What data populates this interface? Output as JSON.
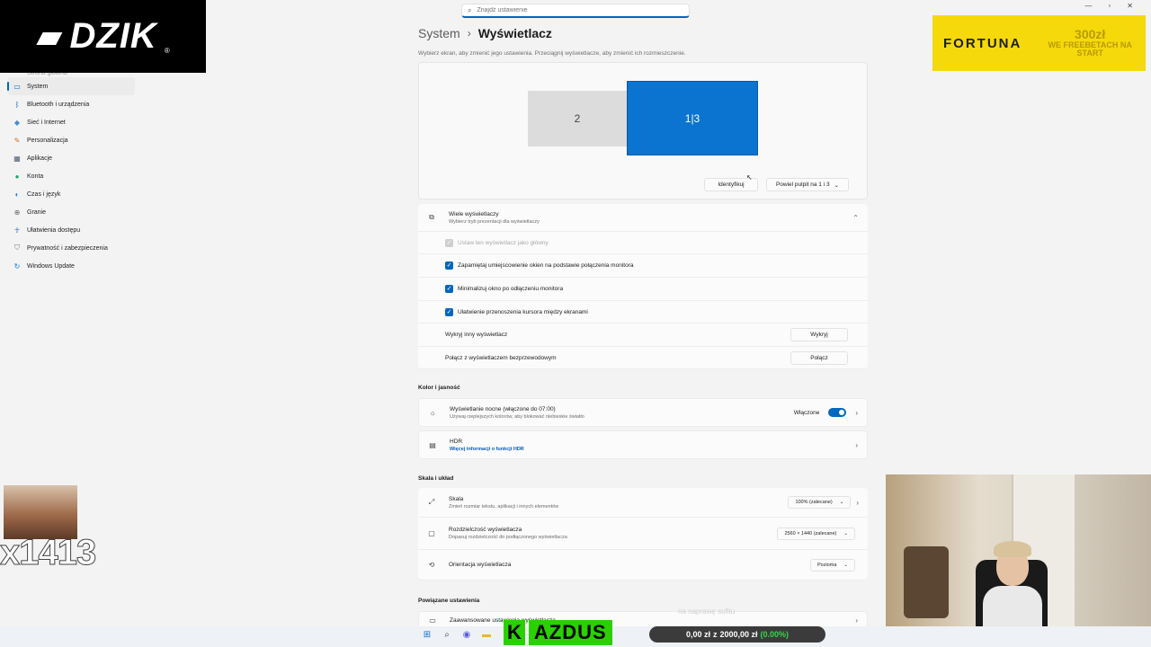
{
  "titlebar": {
    "search_placeholder": "Znajdź ustawienie",
    "search_icon": "search-icon",
    "minimize": "—",
    "maximize": "▫",
    "close": "✕"
  },
  "overlays": {
    "brand_text": "DZIK",
    "brand_reg": "®",
    "brand_icon": "boar-icon",
    "ad_brand": "FORTUNA",
    "ad_amount": "300zł",
    "ad_tagline": "WE FREEBETACH NA START",
    "donor_count": "x1413",
    "streamer_name_k": "K",
    "streamer_name_rest": "AZDUS",
    "bank_text_left": "0,00 zł",
    "bank_text_sep": "z",
    "bank_text_right": "2000,00 zł",
    "bank_pct": "(0.00%)",
    "ghost_text": "na naprawę sufitu"
  },
  "sidebar": {
    "faded_item": "Strona główna",
    "items": [
      {
        "label": "System",
        "icon": "monitor-icon",
        "glyph": "▭",
        "color": "#0067c0"
      },
      {
        "label": "Bluetooth i urządzenia",
        "icon": "bluetooth-icon",
        "glyph": "ᛒ",
        "color": "#0067c0"
      },
      {
        "label": "Sieć i Internet",
        "icon": "wifi-icon",
        "glyph": "◆",
        "color": "#4b8ad6"
      },
      {
        "label": "Personalizacja",
        "icon": "brush-icon",
        "glyph": "✎",
        "color": "#c2702b"
      },
      {
        "label": "Aplikacje",
        "icon": "apps-icon",
        "glyph": "▦",
        "color": "#4d5d73"
      },
      {
        "label": "Konta",
        "icon": "account-icon",
        "glyph": "●",
        "color": "#25a56a"
      },
      {
        "label": "Czas i język",
        "icon": "globe-icon",
        "glyph": "◐",
        "color": "#1b7bd1"
      },
      {
        "label": "Granie",
        "icon": "gamepad-icon",
        "glyph": "⊕",
        "color": "#666"
      },
      {
        "label": "Ułatwienia dostępu",
        "icon": "accessibility-icon",
        "glyph": "☥",
        "color": "#1a63b4"
      },
      {
        "label": "Prywatność i zabezpieczenia",
        "icon": "shield-icon",
        "glyph": "⛉",
        "color": "#777"
      },
      {
        "label": "Windows Update",
        "icon": "update-icon",
        "glyph": "↻",
        "color": "#0a74d0"
      }
    ]
  },
  "header": {
    "breadcrumb_parent": "System",
    "breadcrumb_sep": "›",
    "page_title": "Wyświetlacz",
    "hint": "Wybierz ekran, aby zmienić jego ustawienia. Przeciągnij wyświetlacze, aby zmienić ich rozmieszczenie."
  },
  "monitors": {
    "secondary": "2",
    "primary": "1|3",
    "identify_button": "Identyfikuj",
    "duplicate_dropdown": "Powiel pulpit na 1 i 3",
    "dropdown_arrow": "⌄"
  },
  "multi": {
    "title": "Wiele wyświetlaczy",
    "subtitle": "Wybierz tryb prezentacji dla wyświetlaczy",
    "chevron_up": "⌃",
    "make_main": "Ustaw ten wyświetlacz jako główny",
    "remember": "Zapamiętaj umiejscowienie okien na podstawie połączenia monitora",
    "minimize": "Minimalizuj okno po odłączeniu monitora",
    "ease_cursor": "Ułatwienie przenoszenia kursora między ekranami",
    "detect_label": "Wykryj inny wyświetlacz",
    "detect_button": "Wykryj",
    "wireless_label": "Połącz z wyświetlaczem bezprzewodowym",
    "wireless_button": "Połącz",
    "checkmark": "✓"
  },
  "color": {
    "section": "Kolor i jasność",
    "night_title": "Wyświetlanie nocne (włączone do 07:00)",
    "night_sub": "Używaj cieplejszych kolorów, aby blokować niebieskie światło",
    "night_state": "Włączone",
    "hdr_title": "HDR",
    "hdr_link": "Więcej informacji o funkcji HDR",
    "chevron": "›"
  },
  "layout": {
    "section": "Skala i układ",
    "scale_title": "Skala",
    "scale_sub": "Zmień rozmiar tekstu, aplikacji i innych elementów",
    "scale_value": "100% (zalecane)",
    "res_title": "Rozdzielczość wyświetlacza",
    "res_sub": "Dopasuj rozdzielczość do podłączonego wyświetlacza",
    "res_value": "2560 × 1440 (zalecane)",
    "orient_title": "Orientacja wyświetlacza",
    "orient_value": "Pozioma"
  },
  "related": {
    "section": "Powiązane ustawienia",
    "advanced": "Zaawansowane ustawienia wyświetlacza"
  },
  "taskbar": {
    "icons": [
      "windows-start-icon",
      "search-icon",
      "chat-icon",
      "file-explorer-icon",
      "edge-icon"
    ]
  },
  "colors": {
    "accent": "#0067c0",
    "monitor_primary": "#0a74d0",
    "ad_yellow": "#f5d90a",
    "name_green": "#2bd000"
  }
}
